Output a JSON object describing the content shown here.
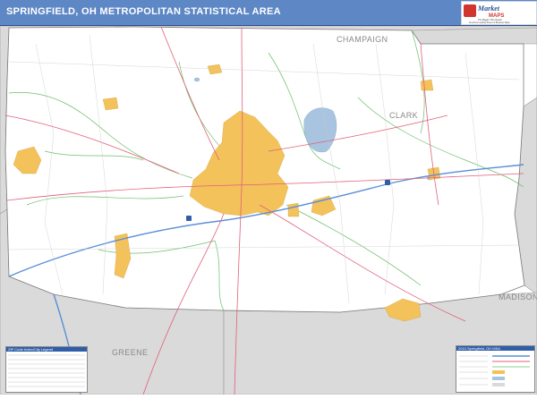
{
  "header": {
    "title": "SPRINGFIELD, OH METROPOLITAN STATISTICAL AREA"
  },
  "logo": {
    "brand_top": "Market",
    "brand_bottom": "MAPS",
    "tagline": "The Bigger The Clearer",
    "subtag": "America's Leading Source of Business Maps"
  },
  "counties": {
    "champaign": "CHAMPAIGN",
    "clark": "CLARK",
    "madison": "MADISON",
    "greene": "GREENE"
  },
  "legend_left": {
    "title": "ZIP Code Index/City Legend"
  },
  "legend_right": {
    "title": "2010 Springfield, OH MSA"
  },
  "colors": {
    "header_bg": "#5d87c5",
    "urban": "#f4c25a",
    "water": "#a9c4e0",
    "outside_county": "#dadada",
    "zip_boundary": "#6cbf6c",
    "highway": "#5a8fd6",
    "road": "#e0607a"
  },
  "icons": [
    "market-maps-logo-icon",
    "interstate-shield-icon"
  ]
}
